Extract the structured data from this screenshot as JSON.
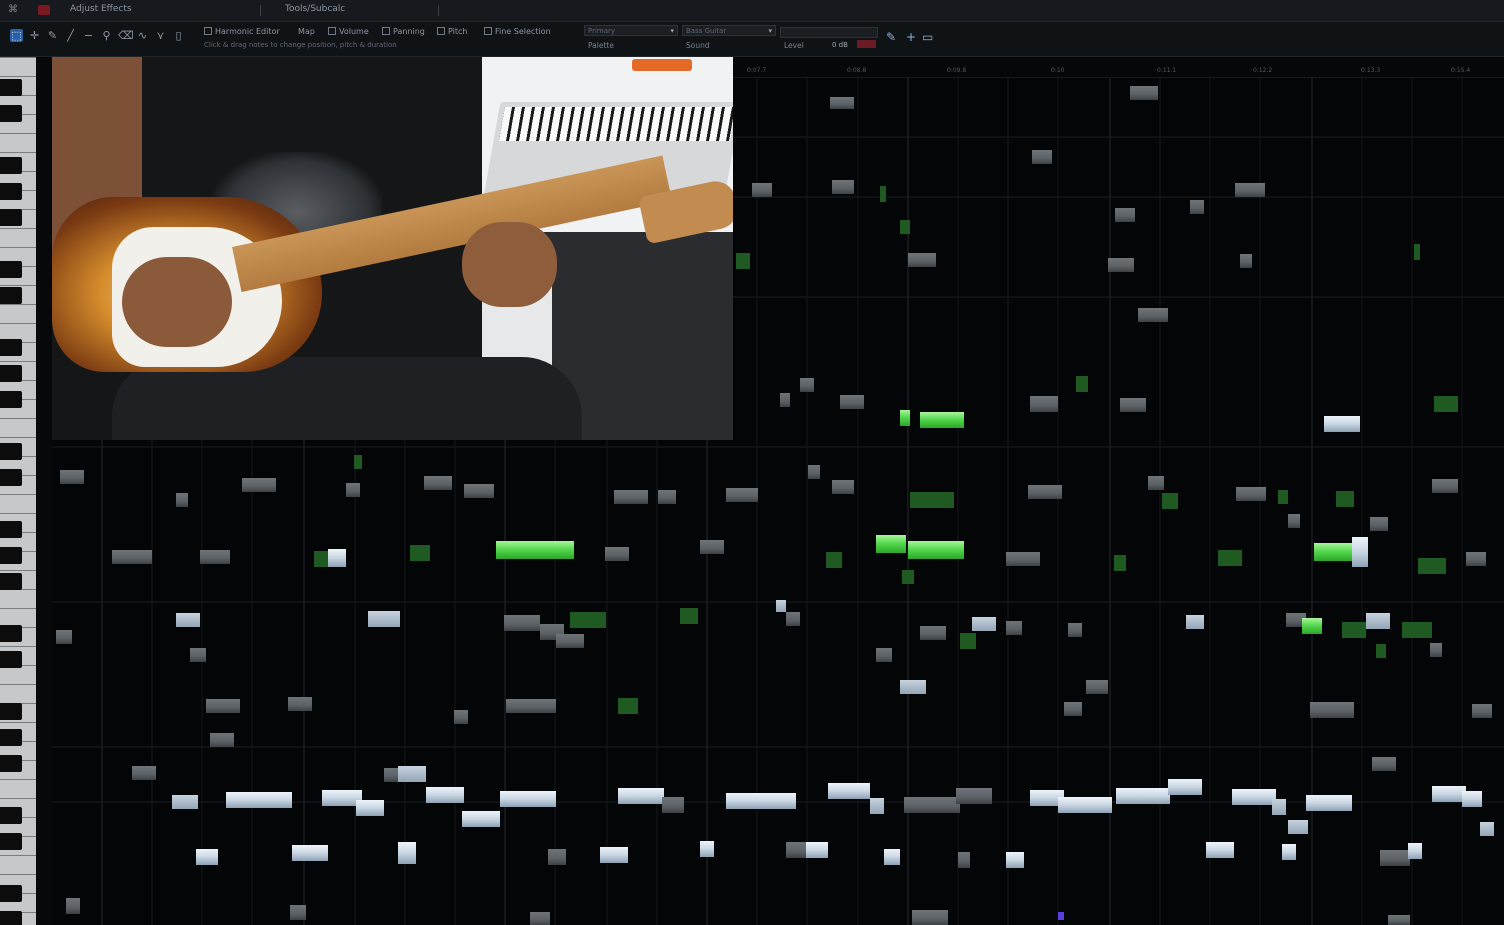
{
  "app": {
    "tabs": [
      "Adjust Effects",
      "Tools/Subcalc"
    ]
  },
  "toolbar": {
    "options": [
      {
        "label": "Harmonic Editor",
        "checked": true
      },
      {
        "label": "Map",
        "checked": false
      },
      {
        "label": "Volume",
        "checked": false
      },
      {
        "label": "Panning",
        "checked": false
      },
      {
        "label": "Pitch",
        "checked": false
      },
      {
        "label": "Fine Selection",
        "checked": false
      }
    ],
    "hint": "Click & drag notes to change position, pitch & duration",
    "palette": {
      "label": "Palette",
      "value": "Primary"
    },
    "sound": {
      "label": "Sound",
      "value": "Bass Guitar"
    },
    "level": {
      "label": "Level",
      "value": "0 dB"
    }
  },
  "ruler": {
    "ticks": [
      "0:07.7",
      "0:08.8",
      "0:09.8",
      "0:10",
      "0:11.1",
      "0:12.2",
      "0:13.3",
      "0:15.4"
    ]
  },
  "colors": {
    "note_gray": "#5c6166",
    "note_blue": "#c9d6e3",
    "note_green": "#4fd54a",
    "note_dark_green": "#1f5a22",
    "accent": "#2a5fa4"
  },
  "video": {
    "description_visible": false
  },
  "icons": {
    "select": "pointer-icon",
    "pencil": "pencil-icon",
    "plus": "plus-icon",
    "folder": "folder-icon"
  }
}
